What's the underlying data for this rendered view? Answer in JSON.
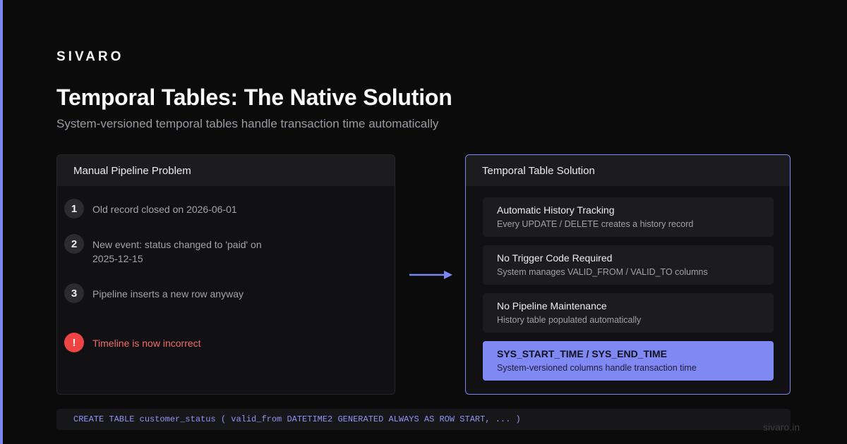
{
  "brand": "SIVARO",
  "title": "Temporal Tables: The Native Solution",
  "subtitle": "System-versioned temporal tables handle transaction time automatically",
  "left_panel": {
    "header": "Manual Pipeline Problem",
    "steps": [
      {
        "badge": "1",
        "text": "Old record closed on 2026-06-01"
      },
      {
        "badge": "2",
        "text": "New event: status changed to 'paid' on 2025-12-15"
      },
      {
        "badge": "3",
        "text": "Pipeline inserts a new row anyway"
      },
      {
        "badge": "!",
        "text": "Timeline is now incorrect"
      }
    ]
  },
  "right_panel": {
    "header": "Temporal Table Solution",
    "features": [
      {
        "title": "Automatic History Tracking",
        "desc": "Every UPDATE / DELETE creates a history record"
      },
      {
        "title": "No Trigger Code Required",
        "desc": "System manages VALID_FROM / VALID_TO columns"
      },
      {
        "title": "No Pipeline Maintenance",
        "desc": "History table populated automatically"
      },
      {
        "title": "SYS_START_TIME / SYS_END_TIME",
        "desc": "System-versioned columns handle transaction time"
      }
    ]
  },
  "code": "CREATE TABLE customer_status ( valid_from DATETIME2 GENERATED ALWAYS AS ROW START, ... )",
  "watermark": "sivaro.in",
  "colors": {
    "accent": "#7c85f2",
    "warning": "#ef4444",
    "background": "#0b0b0c"
  },
  "icons": {
    "arrow": "arrow-right-icon",
    "warning": "exclamation-icon"
  }
}
